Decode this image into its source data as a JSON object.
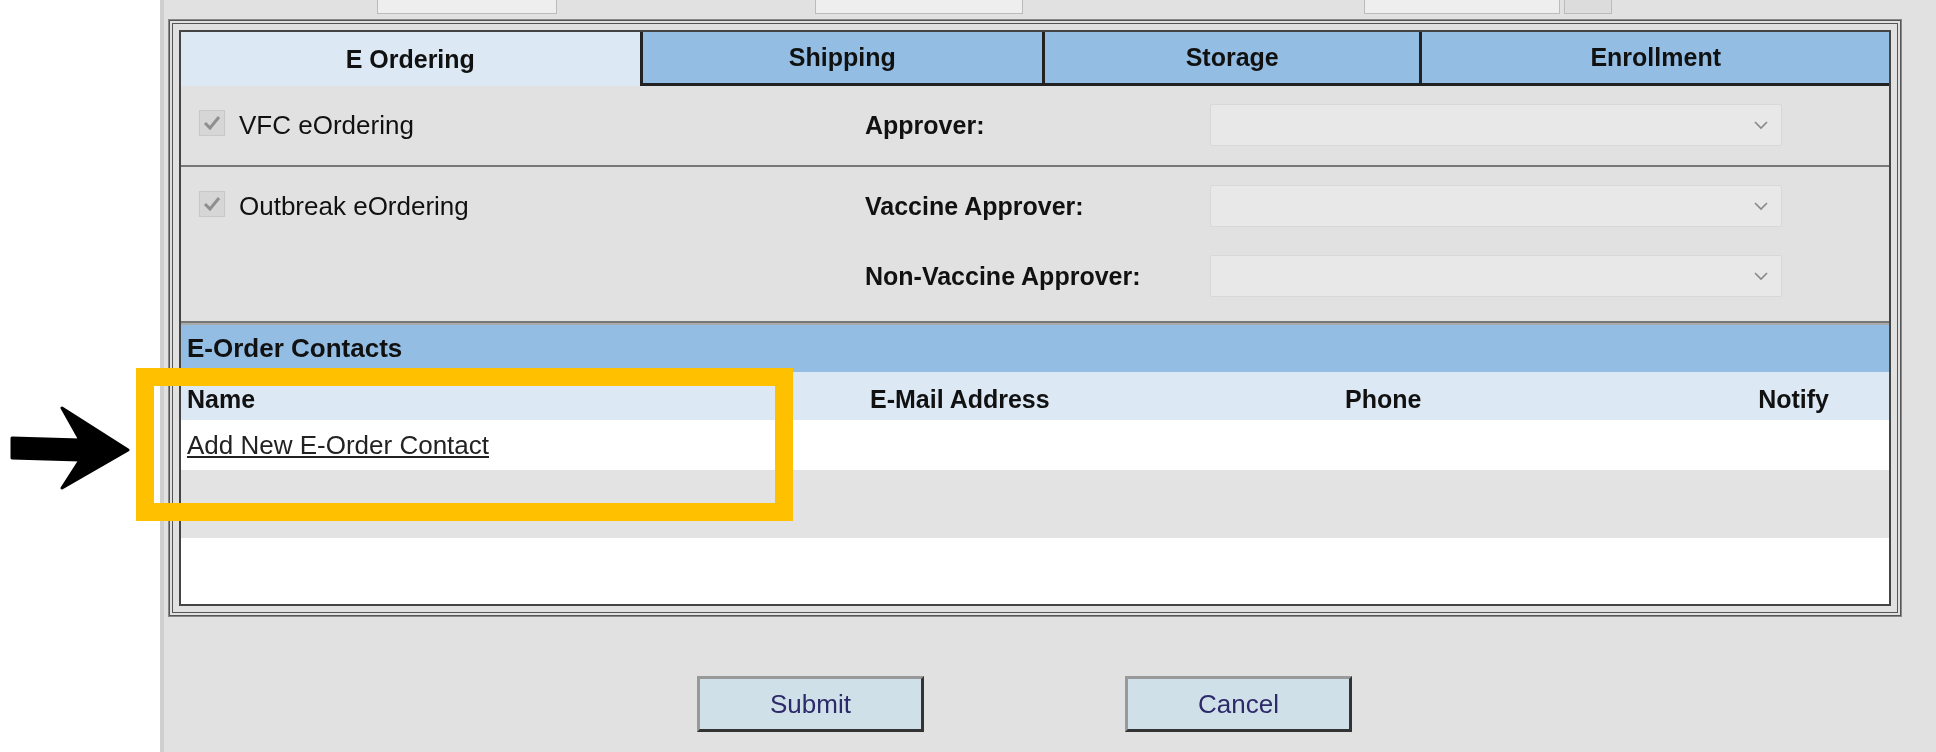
{
  "tabs": [
    {
      "label": "E Ordering",
      "selected": true
    },
    {
      "label": "Shipping",
      "selected": false
    },
    {
      "label": "Storage",
      "selected": false
    },
    {
      "label": "Enrollment",
      "selected": false
    }
  ],
  "sections": [
    {
      "option": {
        "label": "VFC eOrdering",
        "checked": true,
        "disabled": true
      },
      "approvers": [
        {
          "label": "Approver:",
          "disabled": true
        }
      ]
    },
    {
      "option": {
        "label": "Outbreak eOrdering",
        "checked": true,
        "disabled": true
      },
      "approvers": [
        {
          "label": "Vaccine Approver:",
          "disabled": true
        },
        {
          "label": "Non-Vaccine Approver:",
          "disabled": true
        }
      ]
    }
  ],
  "contacts": {
    "title": "E-Order Contacts",
    "columns": [
      "Name",
      "E-Mail Address",
      "Phone",
      "Notify"
    ],
    "add_link": "Add New E-Order Contact"
  },
  "buttons": [
    "Submit",
    "Cancel"
  ]
}
